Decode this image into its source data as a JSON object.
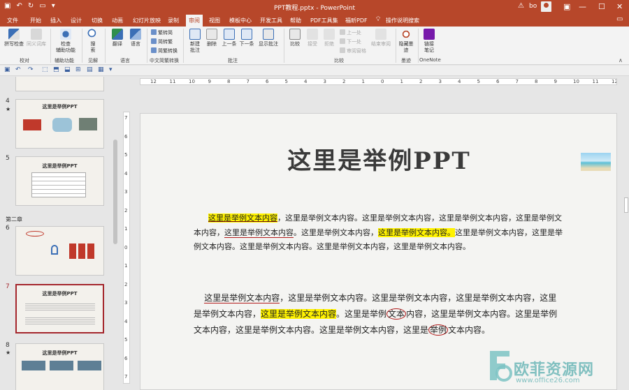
{
  "window": {
    "title": "PPT教程.pptx  -  PowerPoint",
    "user": "bo",
    "warning_icon": "warning-icon",
    "minimize": "—",
    "maximize": "☐",
    "close": "✕",
    "ribbon_display": "▣"
  },
  "qat": {
    "save": "▣",
    "undo": "↶",
    "redo": "↻",
    "present": "▭",
    "more": "▾"
  },
  "tabs": [
    "文件",
    "开始",
    "插入",
    "设计",
    "切换",
    "动画",
    "幻灯片放映",
    "录制",
    "审阅",
    "视图",
    "模板中心",
    "开发工具",
    "帮助",
    "PDF工具集",
    "福昕PDF"
  ],
  "active_tab": "审阅",
  "tell_me": "操作说明搜索",
  "ribbon": {
    "groups": {
      "proofing": "校对",
      "accessibility": "辅助功能",
      "insights": "见解",
      "language": "语言",
      "chinese_conversion": "中文简繁转换",
      "comments": "批注",
      "compare": "比较",
      "ink": "墨迹",
      "onenote": "OneNote"
    },
    "buttons": {
      "spelling": "拼写检查",
      "thesaurus": "同义词库",
      "check_accessibility_1": "检查",
      "check_accessibility_2": "辅助功能",
      "smart_lookup_1": "搜",
      "smart_lookup_2": "索",
      "translate": "翻译",
      "language": "语言",
      "trad_to_simp": "繁转简",
      "simp_to_trad": "简转繁",
      "convert": "简繁转换",
      "new_comment_1": "新建",
      "new_comment_2": "批注",
      "delete": "删除",
      "previous": "上一条",
      "next": "下一条",
      "show_comments": "显示批注",
      "compare": "比较",
      "accept": "接受",
      "reject": "拒绝",
      "prev_change": "上一处",
      "next_change": "下一处",
      "reviewing_pane": "审阅窗格",
      "end_review": "结束审阅",
      "hide_ink_1": "隐藏墨",
      "hide_ink_2": "迹",
      "linked_notes_1": "链接",
      "linked_notes_2": "笔记"
    }
  },
  "strip": {
    "save": "▣",
    "undo": "↶",
    "redo": "↷",
    "icons": [
      "⬚",
      "⬒",
      "⬓",
      "⊞",
      "▤",
      "▦",
      "▾"
    ]
  },
  "thumbnails": {
    "top_partial": "",
    "slides": [
      {
        "num": "4",
        "star": "★",
        "title": "这里是举例PPT"
      },
      {
        "num": "5",
        "star": "",
        "title": "这里是举例PPT"
      },
      {
        "num": "6",
        "star": "",
        "title": ""
      },
      {
        "num": "7",
        "star": "",
        "title": "这里是举例PPT"
      },
      {
        "num": "8",
        "star": "★",
        "title": "这里是举例PPT"
      }
    ],
    "section": "第二章"
  },
  "ruler": {
    "h": [
      "12",
      "11",
      "10",
      "9",
      "8",
      "7",
      "6",
      "5",
      "4",
      "3",
      "2",
      "1",
      "0",
      "1",
      "2",
      "3",
      "4",
      "5",
      "6",
      "7",
      "8",
      "9",
      "10",
      "11",
      "12"
    ],
    "v": [
      "7",
      "6",
      "5",
      "4",
      "3",
      "2",
      "1",
      "0",
      "1",
      "2",
      "3",
      "4",
      "5",
      "6",
      "7"
    ]
  },
  "slide": {
    "title": "这里是举例PPT",
    "p1": [
      "这里是举例文本内容",
      "，这里是举例文本内容。这里是举例文本内容，这里是举例文本内容，这里是举例文本内容，",
      "这里是举例文本内容",
      "。这里是举例文本内容，",
      "这里是举例文本内容。",
      "这里是举例文本内容，这里是举例文本内容。这里是举例文本内容。这里是举例文本内容，这里是举例文本内容。"
    ],
    "p2": [
      "这里是举例文本内容",
      "，这里是举例文本内容。这里是举例文本内容，这里是举例文本内容，这里是举例文本内容，",
      "这里是举例文本内容",
      "。这里是举例",
      "文本",
      "内容，这里是举例文本内容。这里是举例文本内容，这里是举例文本内容。这里是举例文本内容，这里是",
      "举例",
      "文本内容。"
    ]
  },
  "watermark": {
    "text": "欧菲资源网",
    "url": "www.office26.com"
  }
}
